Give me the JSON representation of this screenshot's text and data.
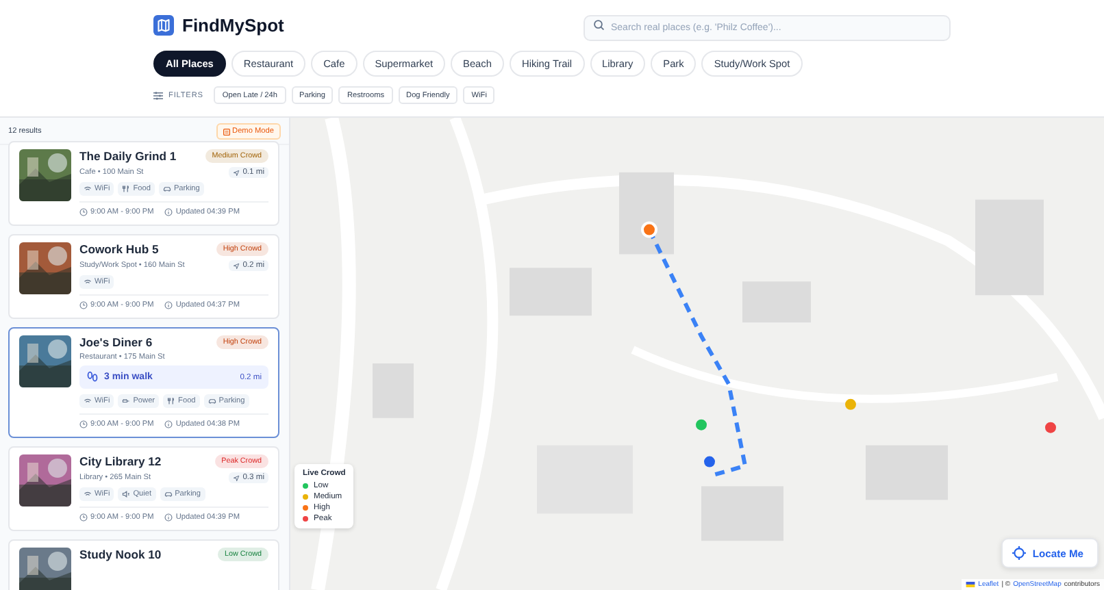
{
  "app": {
    "name": "FindMySpot"
  },
  "search": {
    "placeholder": "Search real places (e.g. 'Philz Coffee')..."
  },
  "categories": [
    {
      "label": "All Places",
      "selected": true
    },
    {
      "label": "Restaurant",
      "selected": false
    },
    {
      "label": "Cafe",
      "selected": false
    },
    {
      "label": "Supermarket",
      "selected": false
    },
    {
      "label": "Beach",
      "selected": false
    },
    {
      "label": "Hiking Trail",
      "selected": false
    },
    {
      "label": "Library",
      "selected": false
    },
    {
      "label": "Park",
      "selected": false
    },
    {
      "label": "Study/Work Spot",
      "selected": false
    }
  ],
  "filters": {
    "label": "FILTERS",
    "options": [
      {
        "label": "Open Late / 24h",
        "selected": false
      },
      {
        "label": "Parking",
        "selected": false
      },
      {
        "label": "Restrooms",
        "selected": false
      },
      {
        "label": "Dog Friendly",
        "selected": false
      },
      {
        "label": "WiFi",
        "selected": false
      }
    ]
  },
  "results": {
    "count": "12 results",
    "mode_badge": "Demo Mode",
    "places": [
      {
        "name": "The Daily Grind 1",
        "color": "#a16207",
        "crowd_label": "Medium Crowd",
        "meta": "Cafe • 100 Main St",
        "distance": "0.1 mi",
        "selected": false,
        "amenities": [
          {
            "kind": "wifi",
            "label": "WiFi"
          },
          {
            "kind": "food",
            "label": "Food"
          },
          {
            "kind": "parking",
            "label": "Parking"
          }
        ],
        "hours": "9:00 AM - 9:00 PM",
        "updated": "Updated 04:39 PM"
      },
      {
        "name": "Cowork Hub 5",
        "color": "#c2410c",
        "crowd_label": "High Crowd",
        "meta": "Study/Work Spot • 160 Main St",
        "distance": "0.2 mi",
        "selected": false,
        "amenities": [
          {
            "kind": "wifi",
            "label": "WiFi"
          }
        ],
        "hours": "9:00 AM - 9:00 PM",
        "updated": "Updated 04:37 PM"
      },
      {
        "name": "Joe's Diner 6",
        "color": "#c2410c",
        "crowd_label": "High Crowd",
        "meta": "Restaurant • 175 Main St",
        "distance": "0.2 mi",
        "selected": true,
        "walk": "3 min walk",
        "amenities": [
          {
            "kind": "wifi",
            "label": "WiFi"
          },
          {
            "kind": "power",
            "label": "Power"
          },
          {
            "kind": "food",
            "label": "Food"
          },
          {
            "kind": "parking",
            "label": "Parking"
          }
        ],
        "hours": "9:00 AM - 9:00 PM",
        "updated": "Updated 04:38 PM"
      },
      {
        "name": "City Library 12",
        "color": "#dc2626",
        "crowd_label": "Peak Crowd",
        "meta": "Library • 265 Main St",
        "distance": "0.3 mi",
        "selected": false,
        "amenities": [
          {
            "kind": "wifi",
            "label": "WiFi"
          },
          {
            "kind": "quiet",
            "label": "Quiet"
          },
          {
            "kind": "parking",
            "label": "Parking"
          }
        ],
        "hours": "9:00 AM - 9:00 PM",
        "updated": "Updated 04:39 PM"
      },
      {
        "name": "Study Nook 10",
        "color": "#15803d",
        "crowd_label": "Low Crowd",
        "selected": false
      }
    ]
  },
  "map": {
    "legend": {
      "title": "Live Crowd",
      "items": [
        {
          "label": "Low",
          "color": "#22c55e"
        },
        {
          "label": "Medium",
          "color": "#eab308"
        },
        {
          "label": "High",
          "color": "#f97316"
        },
        {
          "label": "Peak",
          "color": "#ef4444"
        }
      ]
    },
    "locate_button": "Locate Me",
    "attribution": [
      {
        "kind": "link",
        "text": "Leaflet"
      },
      {
        "kind": "text",
        "text": "| ©"
      },
      {
        "kind": "link",
        "text": "OpenStreetMap"
      },
      {
        "kind": "text",
        "text": "contributors"
      }
    ]
  }
}
